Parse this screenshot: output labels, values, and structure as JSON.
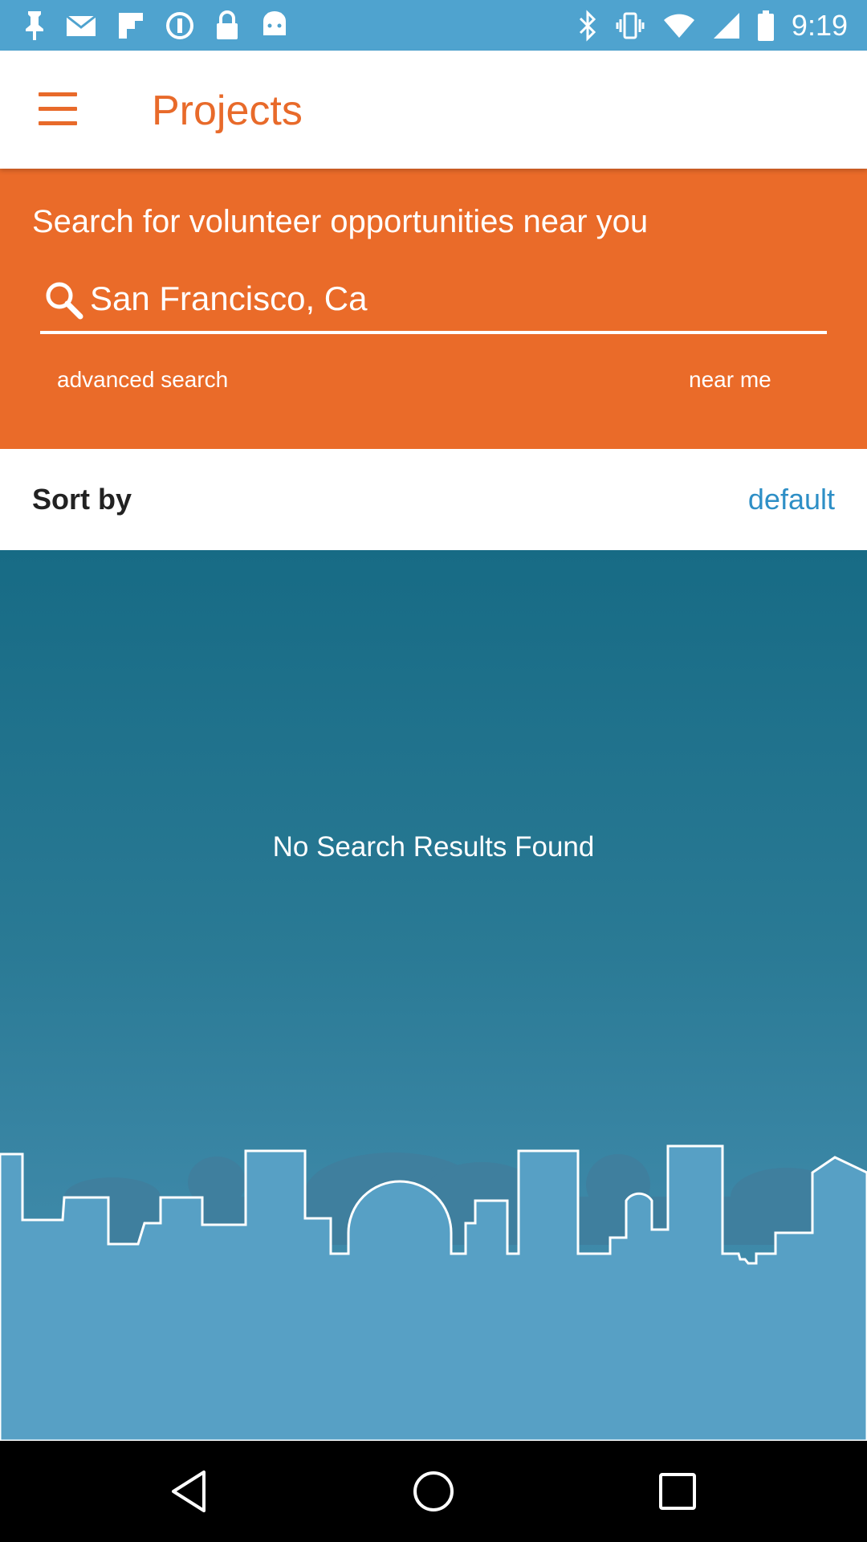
{
  "status_bar": {
    "time": "9:19",
    "left_icons": [
      "pin-icon",
      "mail-icon",
      "flipboard-icon",
      "data-saver-icon",
      "lock-icon",
      "android-icon"
    ],
    "right_icons": [
      "bluetooth-icon",
      "vibrate-icon",
      "wifi-icon",
      "signal-icon",
      "battery-icon"
    ]
  },
  "app_bar": {
    "title": "Projects",
    "menu_icon": "hamburger-menu-icon"
  },
  "search": {
    "heading": "Search for volunteer opportunities near you",
    "location_value": "San Francisco, Ca",
    "advanced_label": "advanced search",
    "near_me_label": "near me"
  },
  "sort": {
    "label": "Sort by",
    "value": "default"
  },
  "results": {
    "empty_message": "No Search Results Found"
  },
  "nav_bar": {
    "buttons": [
      "back-icon",
      "home-icon",
      "recents-icon"
    ]
  },
  "colors": {
    "accent_orange": "#ea6b29",
    "status_bar_blue": "#4fa3cf",
    "link_blue": "#2e8fc6",
    "results_teal": "#176b85",
    "skyline_blue": "#57a0c5"
  }
}
